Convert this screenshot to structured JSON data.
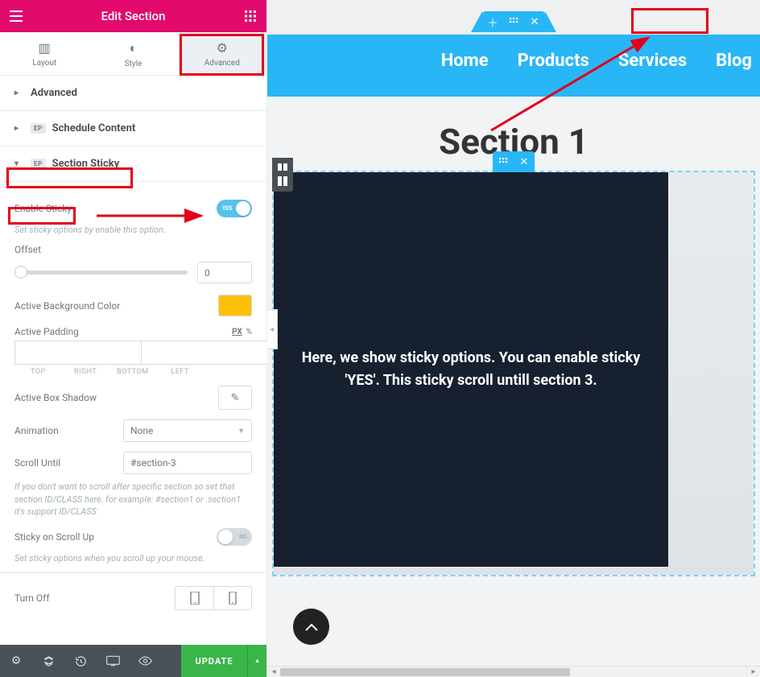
{
  "header": {
    "title": "Edit Section"
  },
  "tabs": {
    "layout": "Layout",
    "style": "Style",
    "advanced": "Advanced"
  },
  "accordion": {
    "advanced": "Advanced",
    "schedule": "Schedule Content",
    "sticky": "Section Sticky",
    "ep_badge": "EP"
  },
  "sticky": {
    "enable_label": "Enable Sticky",
    "enable_help": "Set sticky options by enable this option.",
    "toggle_on": "YES",
    "offset_label": "Offset",
    "offset_value": "0",
    "bg_label": "Active Background Color",
    "bg_color": "#fec007",
    "padding_label": "Active Padding",
    "unit_px": "PX",
    "unit_pct": "%",
    "padding_sides": [
      "TOP",
      "RIGHT",
      "BOTTOM",
      "LEFT"
    ],
    "shadow_label": "Active Box Shadow",
    "anim_label": "Animation",
    "anim_value": "None",
    "scroll_until_label": "Scroll Until",
    "scroll_until_value": "#section-3",
    "scroll_until_help": "If you don't want to scroll after specific section so set that section ID/CLASS here. for example: #section1 or .section1 it's support ID/CLASS",
    "scroll_up_label": "Sticky on Scroll Up",
    "scroll_up_help": "Set sticky options when you scroll up your mouse.",
    "scroll_up_toggle": "NO",
    "turn_off_label": "Turn Off"
  },
  "footer": {
    "update": "UPDATE"
  },
  "preview": {
    "nav": [
      "Home",
      "Products",
      "Services",
      "Blog"
    ],
    "section_title": "Section 1",
    "hero_text": "Here, we show sticky options. You can enable sticky 'YES'. This sticky scroll untill section 3."
  }
}
